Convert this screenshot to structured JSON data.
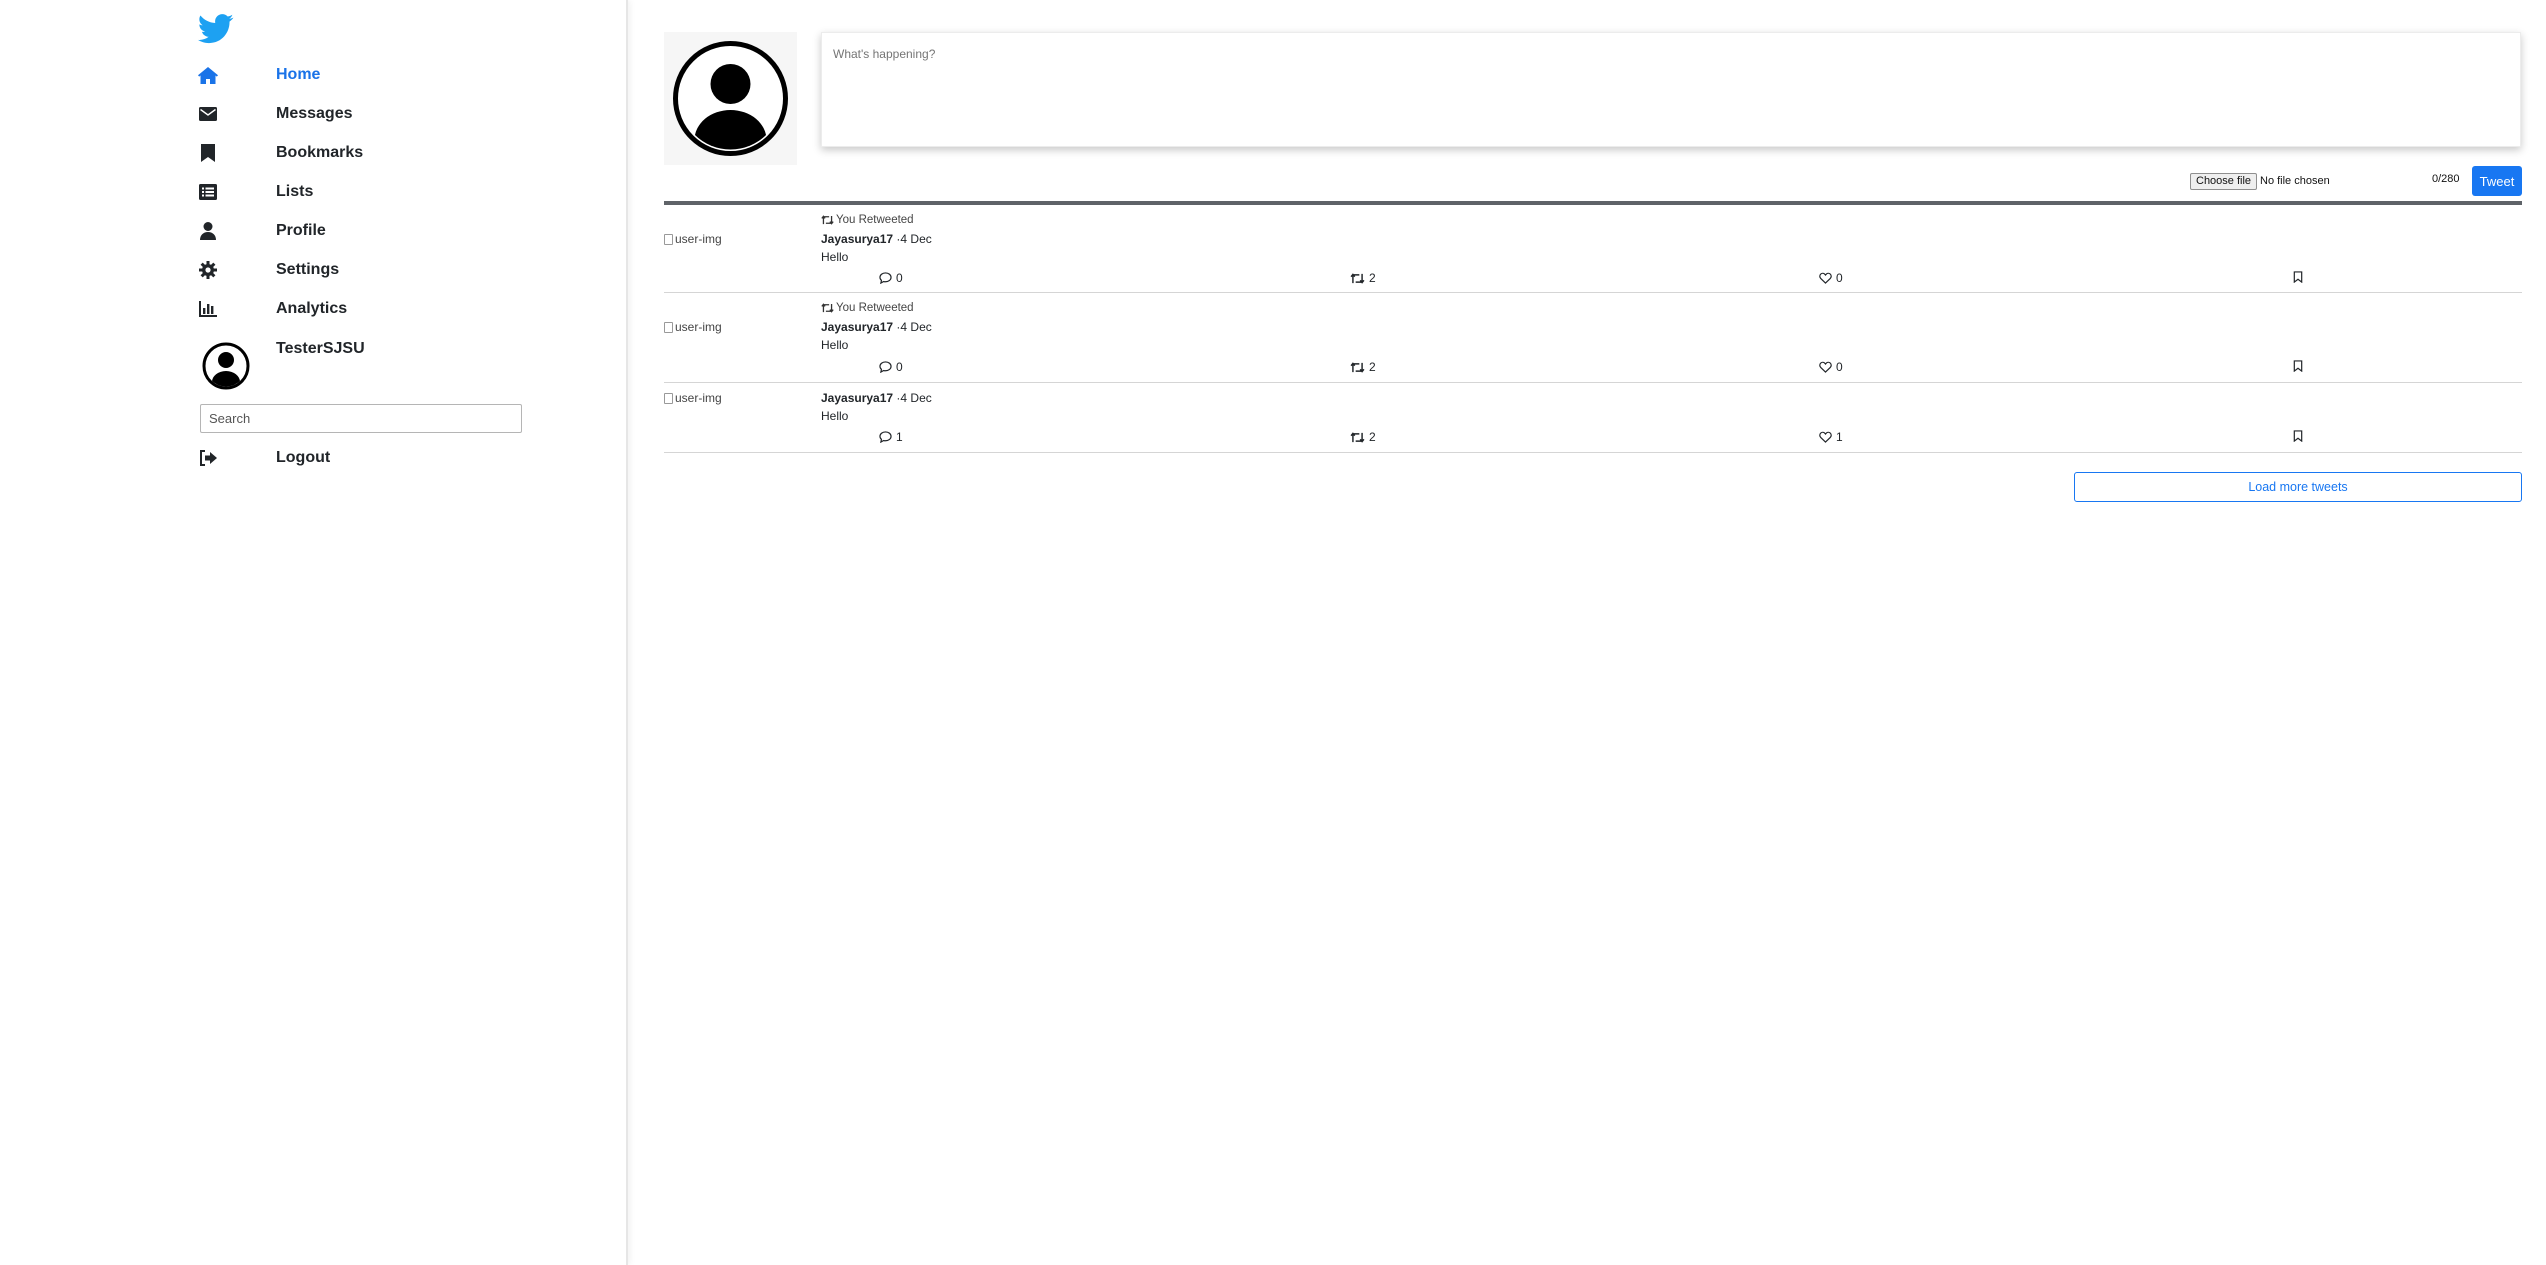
{
  "sidebar": {
    "items": [
      {
        "label": "Home",
        "icon": "home-icon"
      },
      {
        "label": "Messages",
        "icon": "envelope-icon"
      },
      {
        "label": "Bookmarks",
        "icon": "bookmark-icon"
      },
      {
        "label": "Lists",
        "icon": "list-icon"
      },
      {
        "label": "Profile",
        "icon": "user-icon"
      },
      {
        "label": "Settings",
        "icon": "gear-icon"
      },
      {
        "label": "Analytics",
        "icon": "bar-chart-icon"
      }
    ],
    "username": "TesterSJSU",
    "search_placeholder": "Search",
    "logout_label": "Logout"
  },
  "compose": {
    "placeholder": "What's happening?",
    "choose_file_label": "Choose file",
    "file_status": "No file chosen",
    "char_count": "0/280",
    "tweet_button": "Tweet"
  },
  "feed": {
    "tweets": [
      {
        "retweet_label": "You Retweeted",
        "img_alt": "user-img",
        "username": "Jayasurya17",
        "date": "·4 Dec",
        "text": "Hello",
        "comments": "0",
        "retweets": "2",
        "likes": "0"
      },
      {
        "retweet_label": "You Retweeted",
        "img_alt": "user-img",
        "username": "Jayasurya17",
        "date": "·4 Dec",
        "text": "Hello",
        "comments": "0",
        "retweets": "2",
        "likes": "0"
      },
      {
        "retweet_label": "",
        "img_alt": "user-img",
        "username": "Jayasurya17",
        "date": "·4 Dec",
        "text": "Hello",
        "comments": "1",
        "retweets": "2",
        "likes": "1"
      }
    ],
    "load_more_label": "Load more tweets"
  },
  "colors": {
    "accent": "#1877f2",
    "brand": "#1da1f2",
    "text": "#212529"
  }
}
